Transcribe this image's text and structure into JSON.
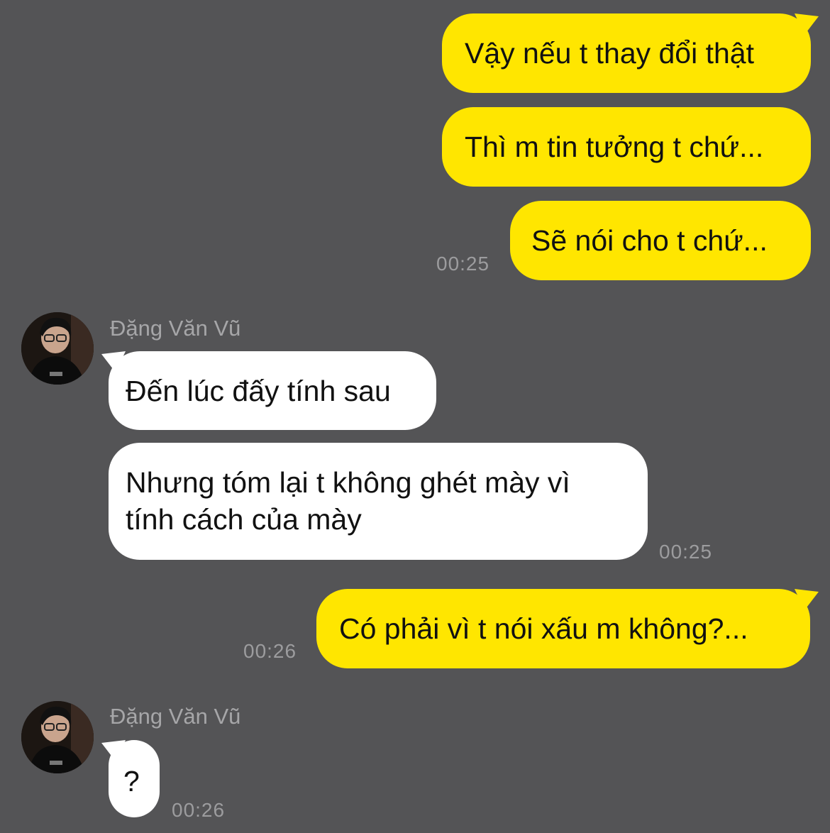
{
  "messages": [
    {
      "text": "Vậy nếu t thay đổi thật"
    },
    {
      "text": "Thì m tin tưởng t chứ..."
    },
    {
      "text": "Sẽ nói cho t chứ..."
    },
    {
      "text": "Đến lúc đấy tính sau"
    },
    {
      "text": "Nhưng tóm lại t không ghét mày vì"
    },
    {
      "text": "tính cách của mày"
    },
    {
      "text": "Có phải vì t nói xấu m không?..."
    },
    {
      "text": "?"
    }
  ],
  "times": [
    "00:25",
    "00:25",
    "00:26",
    "00:26"
  ],
  "senders": [
    {
      "name": "Đặng Văn Vũ",
      "avatar": "profile-photo"
    },
    {
      "name": "Đặng Văn Vũ",
      "avatar": "profile-photo"
    }
  ],
  "colors": {
    "background": "#545456",
    "outgoing_bubble": "#FFE600",
    "incoming_bubble": "#FFFFFF",
    "timestamp": "#9c9c9e",
    "sender_name": "#a6a6a8"
  }
}
